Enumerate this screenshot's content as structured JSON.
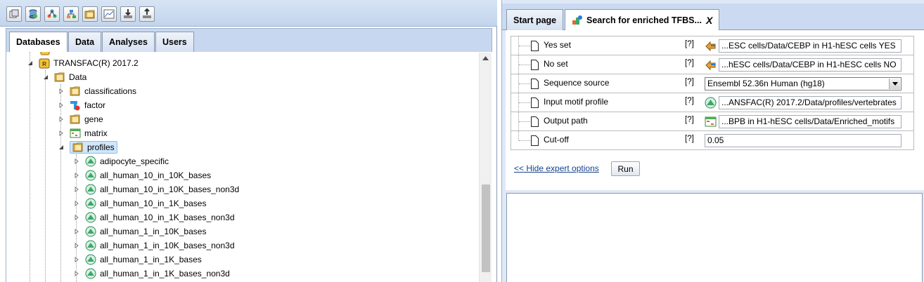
{
  "toolbar": {
    "buttons": [
      {
        "icon": "new-window-icon"
      },
      {
        "icon": "database-refresh-icon"
      },
      {
        "icon": "workflow-icon"
      },
      {
        "icon": "diagram-icon"
      },
      {
        "icon": "folder-icon"
      },
      {
        "icon": "chart-icon"
      },
      {
        "icon": "import-icon"
      },
      {
        "icon": "export-icon"
      }
    ]
  },
  "left_tabs": [
    "Databases",
    "Data",
    "Analyses",
    "Users"
  ],
  "tree": {
    "root": "TRANSFAC(R) 2017.2",
    "data_folder": "Data",
    "data_children": [
      "classifications",
      "factor",
      "gene",
      "matrix",
      "profiles"
    ],
    "profiles_children": [
      "adipocyte_specific",
      "all_human_10_in_10K_bases",
      "all_human_10_in_10K_bases_non3d",
      "all_human_10_in_1K_bases",
      "all_human_10_in_1K_bases_non3d",
      "all_human_1_in_10K_bases",
      "all_human_1_in_10K_bases_non3d",
      "all_human_1_in_1K_bases",
      "all_human_1_in_1K_bases_non3d"
    ]
  },
  "right_tabs": {
    "start": "Start page",
    "active": "Search for enriched TFBS...",
    "close": "X"
  },
  "form": {
    "rows": [
      {
        "label": "Yes set",
        "help": "[?]",
        "value": "...ESC cells/Data/CEBP in H1-hESC cells YES",
        "icon": "dataset-link-icon"
      },
      {
        "label": "No set",
        "help": "[?]",
        "value": "...hESC cells/Data/CEBP in H1-hESC cells NO",
        "icon": "dataset-link-icon"
      },
      {
        "label": "Sequence source",
        "help": "[?]",
        "value": "Ensembl 52.36n Human (hg18)"
      },
      {
        "label": "Input motif profile",
        "help": "[?]",
        "value": "...ANSFAC(R) 2017.2/Data/profiles/vertebrates",
        "icon": "profile-icon"
      },
      {
        "label": "Output path",
        "help": "[?]",
        "value": "...BPB in H1-hESC cells/Data/Enriched_motifs",
        "icon": "table-icon"
      },
      {
        "label": "Cut-off",
        "help": "[?]",
        "value": "0.05"
      }
    ],
    "expert_link": "<< Hide expert options",
    "run_label": "Run"
  }
}
